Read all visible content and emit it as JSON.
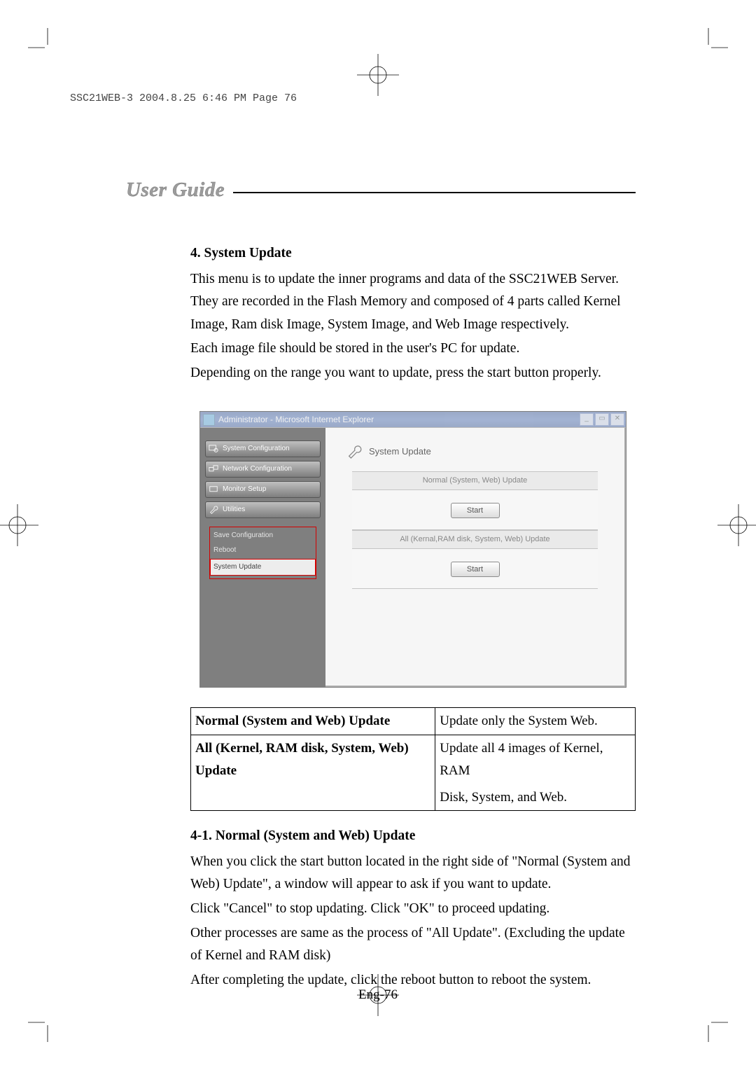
{
  "slugline": "SSC21WEB-3  2004.8.25  6:46 PM  Page 76",
  "banner": "User Guide",
  "section": {
    "heading": "4. System Update",
    "p1": "This menu is to update the inner programs and data of the SSC21WEB Server. They are recorded in the Flash Memory and composed of 4 parts called Kernel Image, Ram disk Image, System Image, and Web Image respectively.",
    "p2": "Each image file should be stored in the user's PC for update.",
    "p3": "Depending on the range you want to update, press the start button properly."
  },
  "ie": {
    "title": "Administrator - Microsoft Internet Explorer",
    "btn_min": "_",
    "btn_max": "▭",
    "btn_close": "✕",
    "nav": {
      "sys": "System Configuration",
      "net": "Network Configuration",
      "mon": "Monitor Setup",
      "util": "Utilities"
    },
    "sub": {
      "save": "Save Configuration",
      "reboot": "Reboot",
      "sysupd": "System Update"
    },
    "main_title": "System Update",
    "panel1_title": "Normal (System, Web) Update",
    "panel2_title": "All (Kernal,RAM disk, System, Web) Update",
    "start": "Start"
  },
  "table": {
    "r1k": "Normal (System and Web) Update",
    "r1v": "Update only the System Web.",
    "r2k": "All (Kernel, RAM disk, System, Web) Update",
    "r2v_a": "Update all 4 images of Kernel, RAM",
    "r2v_b": "Disk, System, and Web."
  },
  "sub41": {
    "heading": "4-1. Normal (System and Web) Update",
    "p1": "When you click the start button located in the right side of \"Normal (System and Web) Update\", a window will appear to ask if you want to update.",
    "p2": "Click \"Cancel\" to stop updating. Click \"OK\" to proceed updating.",
    "p3": "Other processes are same as the process of \"All Update\". (Excluding the update of Kernel and RAM disk)",
    "p4": "After completing the update, click the reboot button to reboot the system."
  },
  "page_number": "Eng-76"
}
